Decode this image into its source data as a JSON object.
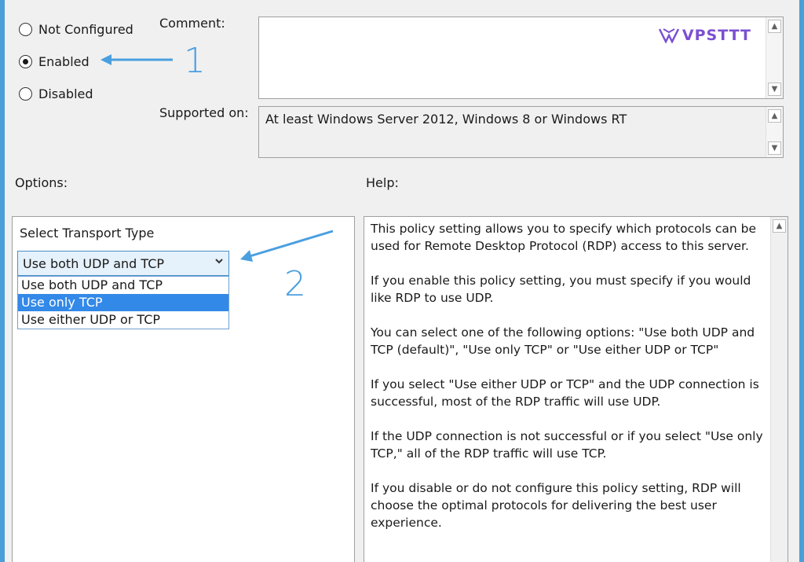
{
  "state": {
    "options": [
      {
        "label": "Not Configured",
        "checked": false
      },
      {
        "label": "Enabled",
        "checked": true
      },
      {
        "label": "Disabled",
        "checked": false
      }
    ]
  },
  "comment": {
    "label": "Comment:",
    "value": ""
  },
  "watermark": {
    "text": "VPSTTT",
    "color": "#7b4fd1"
  },
  "supported": {
    "label": "Supported on:",
    "value": "At least Windows Server 2012, Windows 8 or Windows RT"
  },
  "options_panel": {
    "label": "Options:",
    "field_label": "Select Transport Type",
    "selected_value": "Use both UDP and TCP",
    "dropdown_items": [
      {
        "label": "Use both UDP and TCP",
        "highlighted": false
      },
      {
        "label": "Use only TCP",
        "highlighted": true
      },
      {
        "label": "Use either UDP or TCP",
        "highlighted": false
      }
    ]
  },
  "help_panel": {
    "label": "Help:",
    "paragraphs": [
      "This policy setting allows you to specify which protocols can be used for Remote Desktop Protocol (RDP) access to this server.",
      "If you enable this policy setting, you must specify if you would like RDP to use UDP.",
      "You can select one of the following options: \"Use both UDP and TCP (default)\", \"Use only TCP\" or \"Use either UDP or TCP\"",
      "If you select \"Use either UDP or TCP\" and the UDP connection is successful, most of the RDP traffic will use UDP.",
      "If the UDP connection is not successful or if you select \"Use only TCP,\" all of the RDP traffic will use TCP.",
      "If you disable or do not configure this policy setting, RDP will choose the optimal protocols for delivering the best user experience."
    ]
  },
  "annotations": {
    "one": "1",
    "two": "2",
    "color": "#4a9fe0"
  },
  "icons": {
    "scroll_up": "triangle-up",
    "scroll_down": "triangle-down",
    "combo_arrow": "chevron-down"
  }
}
